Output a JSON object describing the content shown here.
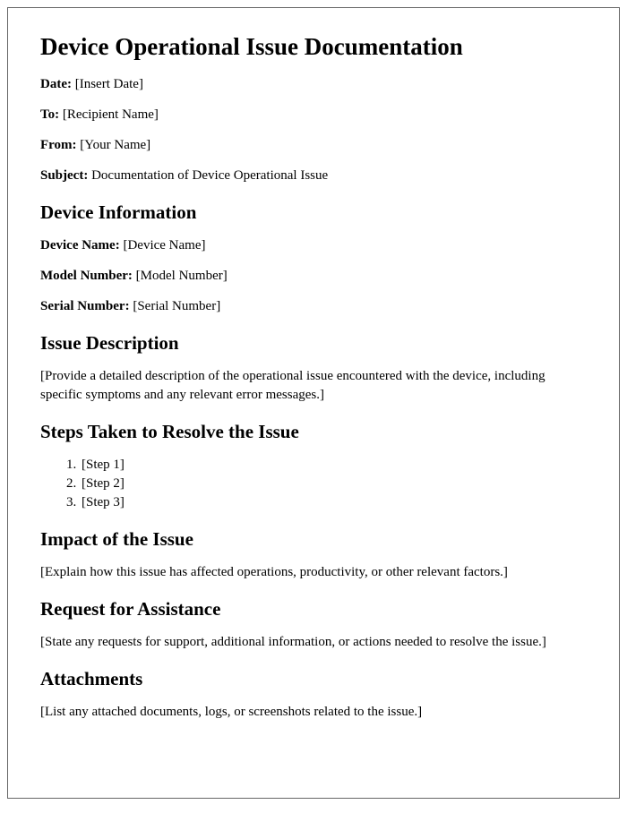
{
  "title": "Device Operational Issue Documentation",
  "header": {
    "date_label": "Date:",
    "date_value": "[Insert Date]",
    "to_label": "To:",
    "to_value": "[Recipient Name]",
    "from_label": "From:",
    "from_value": "[Your Name]",
    "subject_label": "Subject:",
    "subject_value": "Documentation of Device Operational Issue"
  },
  "device_info": {
    "heading": "Device Information",
    "name_label": "Device Name:",
    "name_value": "[Device Name]",
    "model_label": "Model Number:",
    "model_value": "[Model Number]",
    "serial_label": "Serial Number:",
    "serial_value": "[Serial Number]"
  },
  "issue_desc": {
    "heading": "Issue Description",
    "body": "[Provide a detailed description of the operational issue encountered with the device, including specific symptoms and any relevant error messages.]"
  },
  "steps": {
    "heading": "Steps Taken to Resolve the Issue",
    "items": {
      "0": "[Step 1]",
      "1": "[Step 2]",
      "2": "[Step 3]"
    }
  },
  "impact": {
    "heading": "Impact of the Issue",
    "body": "[Explain how this issue has affected operations, productivity, or other relevant factors.]"
  },
  "request": {
    "heading": "Request for Assistance",
    "body": "[State any requests for support, additional information, or actions needed to resolve the issue.]"
  },
  "attachments": {
    "heading": "Attachments",
    "body": "[List any attached documents, logs, or screenshots related to the issue.]"
  }
}
